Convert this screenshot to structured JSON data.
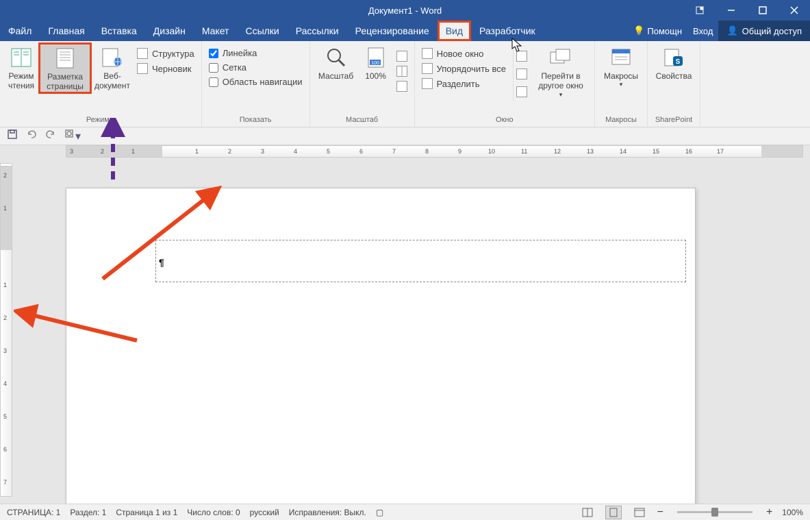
{
  "title": "Документ1 - Word",
  "tabs": {
    "file": "Файл",
    "home": "Главная",
    "insert": "Вставка",
    "design": "Дизайн",
    "layout": "Макет",
    "references": "Ссылки",
    "mailings": "Рассылки",
    "review": "Рецензирование",
    "view": "Вид",
    "developer": "Разработчик"
  },
  "actions": {
    "help": "Помощн",
    "login": "Вход",
    "share": "Общий доступ"
  },
  "ribbon": {
    "views": {
      "read": "Режим чтения",
      "print": "Разметка страницы",
      "web": "Веб-документ",
      "outline": "Структура",
      "draft": "Черновик",
      "group": "Режимы"
    },
    "show": {
      "ruler": "Линейка",
      "grid": "Сетка",
      "nav": "Область навигации",
      "group": "Показать"
    },
    "zoom": {
      "zoom": "Масштаб",
      "hundred": "100%",
      "group": "Масштаб"
    },
    "window": {
      "neww": "Новое окно",
      "arrange": "Упорядочить все",
      "split": "Разделить",
      "switch_l1": "Перейти в",
      "switch_l2": "другое окно",
      "group": "Окно"
    },
    "macros": {
      "macros": "Макросы",
      "group": "Макросы"
    },
    "sp": {
      "props": "Свойства",
      "group": "SharePoint"
    }
  },
  "status": {
    "page": "СТРАНИЦА: 1",
    "section": "Раздел: 1",
    "pageof": "Страница 1 из 1",
    "words": "Число слов: 0",
    "lang": "русский",
    "track": "Исправления: Выкл.",
    "zoom": "100%"
  },
  "zoom_controls": {
    "minus": "−",
    "plus": "+"
  }
}
